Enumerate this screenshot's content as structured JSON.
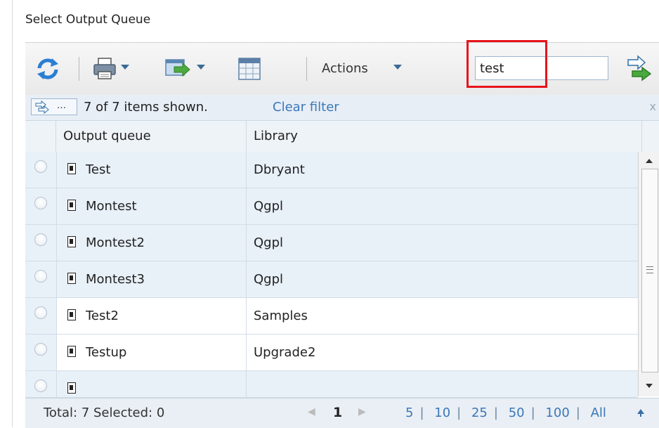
{
  "page": {
    "title": "Select Output Queue"
  },
  "toolbar": {
    "refresh_icon": "refresh-icon",
    "print_icon": "printer-icon",
    "export_icon": "export-icon",
    "columns_icon": "table-columns-icon",
    "actions_label": "Actions",
    "search_value": "test",
    "go_icon": "filter-go-icon",
    "highlight_color": "#e8141b"
  },
  "filter": {
    "button_label": "…",
    "count_text": "7 of 7 items shown.",
    "clear_label": "Clear filter",
    "close_label": "x"
  },
  "table": {
    "columns": [
      "Output queue",
      "Library"
    ],
    "rows": [
      {
        "queue": "Test",
        "library": "Dbryant"
      },
      {
        "queue": "Montest",
        "library": "Qgpl"
      },
      {
        "queue": "Montest2",
        "library": "Qgpl"
      },
      {
        "queue": "Montest3",
        "library": "Qgpl"
      },
      {
        "queue": "Test2",
        "library": "Samples"
      },
      {
        "queue": "Testup",
        "library": "Upgrade2"
      }
    ]
  },
  "footer": {
    "total_text": "Total: 7 Selected: 0",
    "current_page": "1",
    "page_sizes": [
      "5",
      "10",
      "25",
      "50",
      "100",
      "All"
    ]
  }
}
